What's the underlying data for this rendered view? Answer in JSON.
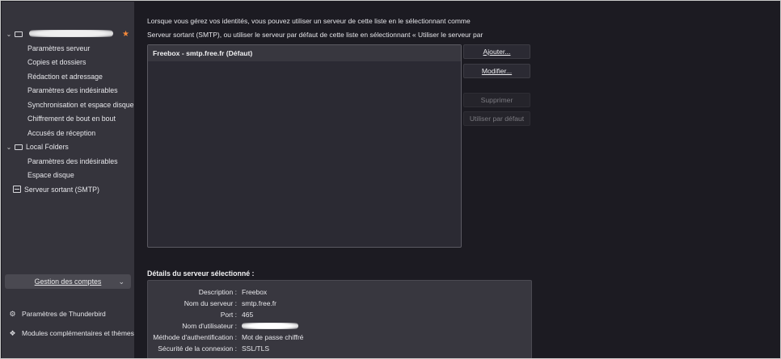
{
  "sidebar": {
    "account": {
      "name_hidden": true
    },
    "account_items": [
      {
        "label": "Paramètres serveur"
      },
      {
        "label": "Copies et dossiers"
      },
      {
        "label": "Rédaction et adressage"
      },
      {
        "label": "Paramètres des indésirables"
      },
      {
        "label": "Synchronisation et espace disque"
      },
      {
        "label": "Chiffrement de bout en bout"
      },
      {
        "label": "Accusés de réception"
      }
    ],
    "local_folders": {
      "label": "Local Folders",
      "items": [
        {
          "label": "Paramètres des indésirables"
        },
        {
          "label": "Espace disque"
        }
      ]
    },
    "outgoing": {
      "label": "Serveur sortant (SMTP)"
    },
    "accounts_button": {
      "label": "Gestion des comptes"
    },
    "links": [
      {
        "label": "Paramètres de Thunderbird",
        "icon": "gear-icon"
      },
      {
        "label": "Modules complémentaires et thèmes",
        "icon": "puzzle-icon"
      }
    ]
  },
  "main": {
    "intro": "Lorsque vous gérez vos identités, vous pouvez utiliser un serveur de cette liste en le sélectionnant comme Serveur sortant (SMTP), ou utiliser le serveur par défaut de cette liste en sélectionnant « Utiliser le serveur par défaut ».",
    "servers": [
      {
        "label": "Freebox - smtp.free.fr (Défaut)",
        "selected": true
      }
    ],
    "buttons": {
      "add": "Ajouter...",
      "edit": "Modifier...",
      "delete": "Supprimer",
      "set_default": "Utiliser par défaut"
    },
    "details": {
      "title": "Détails du serveur sélectionné :",
      "rows": [
        {
          "key": "Description :",
          "value": "Freebox"
        },
        {
          "key": "Nom du serveur :",
          "value": "smtp.free.fr"
        },
        {
          "key": "Port :",
          "value": "465"
        },
        {
          "key": "Nom d'utilisateur :",
          "value": ""
        },
        {
          "key": "Méthode d'authentification :",
          "value": "Mot de passe chiffré"
        },
        {
          "key": "Sécurité de la connexion :",
          "value": "SSL/TLS"
        }
      ]
    }
  },
  "colors": {
    "sidebar_bg": "#35343c",
    "main_bg": "#1c1b22",
    "list_bg": "#2b2a33",
    "star": "#f5893a"
  }
}
